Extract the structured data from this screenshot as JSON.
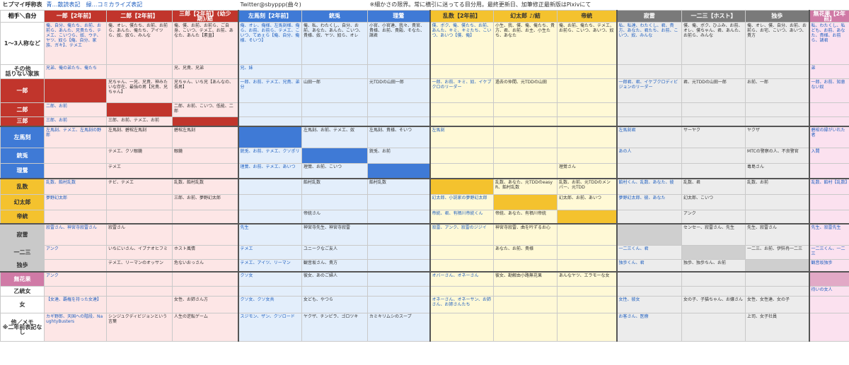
{
  "top": {
    "title": "ヒプマイ呼称表",
    "legend": "青…散読表記　緑…コミカライズ表記",
    "twitter": "Twitter@sbyppp(曲々)",
    "note": "※細かさの限界。常に横引に迷ってる目分用。最終更新日、加筆修正最新版はPixivにて"
  },
  "corner": "相手＼自分",
  "columns": [
    {
      "label": "一郎【2年前】",
      "group": "1"
    },
    {
      "label": "二郎【2年前】",
      "group": "1"
    },
    {
      "label": "三郎【2年前】(幼少期)/結",
      "group": "1"
    },
    {
      "label": "左馬刻【2年前】",
      "group": "2"
    },
    {
      "label": "銃兎",
      "group": "2"
    },
    {
      "label": "理鶯",
      "group": "2"
    },
    {
      "label": "乱数【2年前】",
      "group": "3"
    },
    {
      "label": "幻太郎 ♪/結",
      "group": "3"
    },
    {
      "label": "帝統",
      "group": "3"
    },
    {
      "label": "寂雷",
      "group": "4"
    },
    {
      "label": "一二三【ホスト】",
      "group": "4"
    },
    {
      "label": "独歩",
      "group": "4"
    },
    {
      "label": "無花果【2年前】",
      "group": "5"
    }
  ],
  "rows": [
    {
      "label": "1～3人称など",
      "cls": "r0",
      "h": 60,
      "cells": [
        "俺、自分、俺たち、お前、お前ら、あんた、兄貴たち、テメエ、こいつら、奴、ウチ、ヤツ、奴ら【俺、自分、家族、ガキ】、テメエ",
        "俺、オレ、僕たち、お前、お前ら、あんた、俺たち、アイツら、奴、奴ら、みんな",
        "俺、僕、お前、お前ら、ご自身、こいつ、テメエ、お前、あなた、あんた【素直】",
        "俺、オレ、俺様、左馬刻様、俺ら、お前、お前ら、テメエ、こいつ、てめぇら【俺、自分、俺様、そいつ】",
        "俺、私、わたくし、自分、お前、あなた、あんた、こいつ、貴様、奴、ヤツ、奴ら、オレ",
        "小官、小官達、我々、貴官、貴様、お前、貴殿、そなた、諸君",
        "僕、ボク、俺、僕たち、お前、あんた、キミ、キミたち、こいつ、あいつ【僕、俺】",
        "小生、我、僕、俺、俺たち、貴方、君、お前、お主、小生たち、あなた",
        "俺、お前、俺たち、テメエ、お前ら、こいつ、あいつ、奴",
        "私、私達、わたくし、君、貴方、あなた、君たち、お前、こいつ、奴、みんな",
        "僕、俺、ボク、ひふみ、お前、オレ、僕ちゃん、君、あんた、お前ら、みんな",
        "俺、オレ、僕、自分、お前、お前ら、お宅、こいつ、あいつ、貴方",
        "私、わたくし、私ども、お前、あなた、貴様、お前ら、諸君"
      ]
    },
    {
      "label": "その他\n話りない家族",
      "cls": "r0",
      "h": 20,
      "cells": [
        "兄弟、俺の弟たち、俺たち",
        "",
        "兄、兄貴、兄弟",
        "兄、妹",
        "",
        "",
        "",
        "",
        "",
        "",
        "",
        "",
        "弟"
      ]
    },
    {
      "label": "一郎",
      "cls": "r1",
      "h": 34,
      "cells": [
        "#self1",
        "兄ちゃん、一兄、兄貴、神みたいな存在、最強の男【兄貴、兄ちゃん】",
        "兄ちゃん、いち兄【あんなの、長男】",
        "一郎、お前、テメエ、兄貴、弟分",
        "山田一郎",
        "元TDDの山田一郎",
        "一郎、お前、キミ、奴、イケブクロのリーダー",
        "過去の仲間、元TDDの山田",
        "",
        "一郎君、君、イケブクロディビジョンのリーダー",
        "君、元TDDの山田一郎",
        "お前、一郎",
        "一郎、お前、知恵ない奴"
      ]
    },
    {
      "label": "二郎",
      "cls": "r1",
      "h": 20,
      "cells": [
        "二郎、お前",
        "#self1",
        "二郎、お前、こいつ、低能、二郎",
        "",
        "",
        "",
        "",
        "",
        "",
        "",
        "",
        "",
        ""
      ]
    },
    {
      "label": "三郎",
      "cls": "r1 thick-b",
      "h": 14,
      "cells": [
        "三郎、お前",
        "三郎、お前、テメエ、お前",
        "#self1",
        "",
        "",
        "",
        "",
        "",
        "",
        "",
        "",
        "",
        ""
      ]
    },
    {
      "label": "左馬刻",
      "cls": "r2",
      "h": 30,
      "cells": [
        "左馬刻、テメエ、左馬刻の野郎",
        "左馬刻、碧棺左馬刻",
        "碧棺左馬刻",
        "#self2",
        "左馬刻、お前、テメエ、奴",
        "左馬刻、貴様、そいつ",
        "左馬刻",
        "",
        "",
        "左馬刻君",
        "サーヤク",
        "ヤクザ",
        "碧棺の縁がいれた者"
      ]
    },
    {
      "label": "銃兎",
      "cls": "r2",
      "h": 22,
      "cells": [
        "",
        "テメエ、クソ眼鏡",
        "眼鏡",
        "銃兎、お前、テメエ、クソポリ",
        "#self2",
        "銃兎、お前",
        "",
        "",
        "",
        "あの人",
        "",
        "MTCの警察の人、不良警官",
        "入間"
      ]
    },
    {
      "label": "理鶯",
      "cls": "r2 thick-b",
      "h": 22,
      "cells": [
        "",
        "テメエ",
        "",
        "理鶯、お前、テメエ、あいつ",
        "理鶯、お前、こいつ",
        "#self2",
        "",
        "",
        "理鶯さん",
        "",
        "",
        "毒島さん",
        ""
      ]
    },
    {
      "label": "乱数",
      "cls": "r3",
      "h": 22,
      "cells": [
        "乱数、飴村乱数",
        "チビ、テメエ",
        "乱数、飴村乱数",
        "",
        "飴村乱数",
        "飴村乱数",
        "#self3",
        "乱数、あなた、元TDDのeasyR、飴村乱数",
        "乱数、お前、元TDDのメンバー、元TDD",
        "飴村くん、乱数、あなた、彼",
        "乱数、君",
        "乱数、お前",
        "乱数、飴村【乱数】"
      ]
    },
    {
      "label": "幻太郎",
      "cls": "r3",
      "h": 22,
      "cells": [
        "夢野幻太郎",
        "",
        "三郎、お前、夢野幻太郎",
        "",
        "",
        "",
        "幻太郎、小説家の夢野幻太郎",
        "#self3",
        "幻太郎、お前、あいつ",
        "夢野幻太郎、彼、あなた",
        "幻太郎、こいつ",
        "",
        ""
      ]
    },
    {
      "label": "帝統",
      "cls": "r3 thick-b",
      "h": 20,
      "cells": [
        "",
        "",
        "",
        "",
        "帝統さん",
        "",
        "帝統、君、有栖川帝統くん",
        "帝統、あなた、有栖川帝統",
        "#self3",
        "",
        "アンク",
        "",
        ""
      ]
    },
    {
      "label": "寂雷",
      "cls": "r4",
      "h": 30,
      "cells": [
        "寂雷さん、神宮寺寂雷さん",
        "寂雷さん",
        "",
        "先生",
        "神宮寺先生、神宮寺寂雷",
        "",
        "寂雷、アンク、寂雷のジジイ",
        "神宮寺寂雷、曲を吟ずるお心",
        "",
        "#self4",
        "センセー、寂雷さん、先生",
        "先生、寂雷さん",
        "先生、寂雷先生"
      ]
    },
    {
      "label": "一二三",
      "cls": "r4",
      "h": 20,
      "cells": [
        "アンク",
        "いちにいさん、イブナオヒフミ",
        "ホスト風情",
        "テメエ",
        "ユニークなご友人",
        "",
        "",
        "あなた、お前、貴様",
        "",
        "一二三くん、君",
        "#self4",
        "一二三、お前、伊弉冉一二三",
        "一二三くん、一二三"
      ]
    },
    {
      "label": "独歩",
      "cls": "r4 thick-b",
      "h": 18,
      "cells": [
        "",
        "テメエ、リーマンのオッサン",
        "危ないおっさん",
        "テメエ、アイツ、リーマン",
        "観音坂さん、貴方",
        "",
        "",
        "",
        "",
        "独歩くん、君",
        "独歩、独歩ちん、お前",
        "#self4",
        "観音坂独歩"
      ]
    },
    {
      "label": "無花果",
      "cls": "r5",
      "h": 20,
      "cells": [
        "アンク",
        "",
        "",
        "クソ女",
        "彼女、あのご婦人",
        "",
        "オバーさん、オネーさん",
        "彼女、勘解由小路無花果",
        "あんなヤツ、エラモーな女",
        "",
        "",
        "",
        "#self5"
      ]
    },
    {
      "label": "乙統女",
      "cls": "r0",
      "h": 14,
      "cells": [
        "",
        "",
        "",
        "",
        "",
        "",
        "",
        "",
        "",
        "",
        "",
        "",
        "待いの女人"
      ]
    },
    {
      "label": "女",
      "cls": "r0",
      "h": 24,
      "cells": [
        "【女達、覇権を持った女達】",
        "",
        "女性、お姉さん方",
        "クソ女、クソ女共",
        "女ども、やつら",
        "",
        "オネーさん、オネーサン、お姉さん、お姉さんたち",
        "",
        "",
        "女性、彼女",
        "女の子、子猫ちゃん、お嬢さん",
        "女性、女性達、女の子",
        ""
      ]
    },
    {
      "label": "他／メモ\n※二年前表記なし",
      "cls": "r0",
      "h": 40,
      "cells": [
        "カギ野郎、天国への階段、NaughtyBusters",
        "シンジュクディビジョンという言葉",
        "人生の逆転ゲーム",
        "スジモン、ザン、クソロード",
        "ヤクザ、チンピラ、ゴロツキ",
        "カミキリムシのスープ",
        "",
        "",
        "",
        "お客さん、医療",
        "",
        "上司、女子社員",
        ""
      ]
    }
  ]
}
